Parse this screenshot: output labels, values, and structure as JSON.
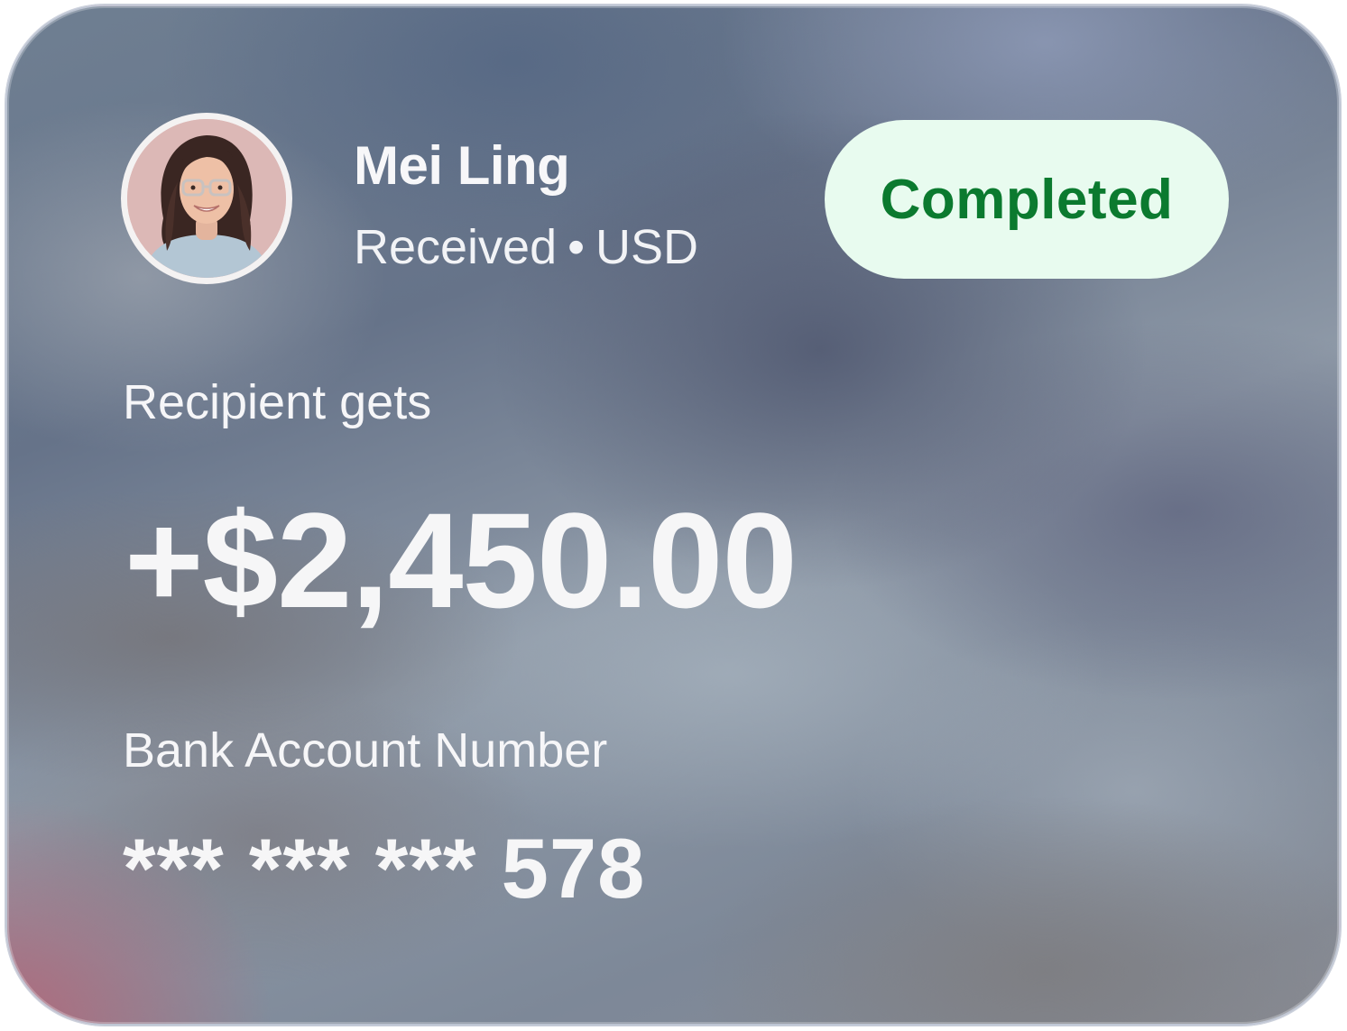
{
  "profile": {
    "name": "Mei Ling",
    "direction": "Received",
    "separator": "•",
    "currency": "USD",
    "avatar_icon": "profile-photo"
  },
  "status": {
    "label": "Completed",
    "text_color": "#0b7a2f",
    "background_color": "#e8fbef"
  },
  "recipient": {
    "label": "Recipient gets",
    "amount": "+$2,450.00"
  },
  "bank": {
    "label": "Bank Account Number",
    "masked_number": "*** *** *** 578"
  }
}
